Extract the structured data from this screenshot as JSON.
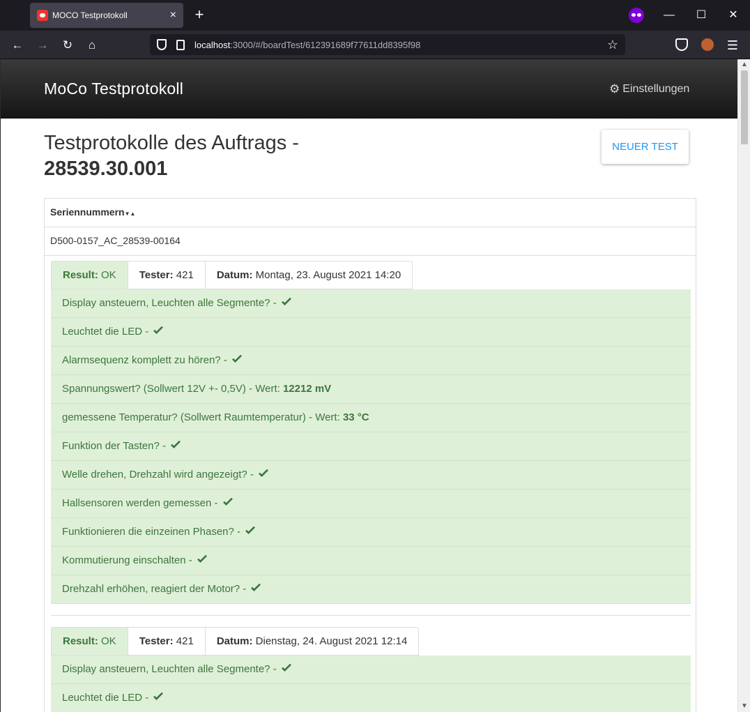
{
  "browser": {
    "tab_title": "MOCO Testprotokoll",
    "tab_close": "×",
    "new_tab": "+",
    "url_host": "localhost",
    "url_rest": ":3000/#/boardTest/612391689f77611dd8395f98",
    "window_minimize": "—",
    "window_maximize": "☐",
    "window_close": "✕"
  },
  "app": {
    "title": "MoCo Testprotokoll",
    "settings_label": "Einstellungen"
  },
  "page": {
    "heading_line1": "Testprotokolle des Auftrags -",
    "order_number": "28539.30.001",
    "new_test_button": "NEUER TEST"
  },
  "table": {
    "column_header": "Seriennummern",
    "serial_number": "D500-0157_AC_28539-00164"
  },
  "tests": [
    {
      "result_label": "Result:",
      "result_value": "OK",
      "tester_label": "Tester:",
      "tester_value": "421",
      "date_label": "Datum:",
      "date_value": "Montag, 23. August 2021 14:20",
      "items": [
        {
          "text": "Display ansteuern, Leuchten alle Segmente? - ",
          "value": "",
          "check": true
        },
        {
          "text": "Leuchtet die LED - ",
          "value": "",
          "check": true
        },
        {
          "text": "Alarmsequenz komplett zu hören? - ",
          "value": "",
          "check": true
        },
        {
          "text": "Spannungswert? (Sollwert 12V +- 0,5V) - Wert: ",
          "value": "12212 mV",
          "check": false
        },
        {
          "text": "gemessene Temperatur? (Sollwert Raumtemperatur) - Wert: ",
          "value": "33 °C",
          "check": false
        },
        {
          "text": "Funktion der Tasten? - ",
          "value": "",
          "check": true
        },
        {
          "text": "Welle drehen, Drehzahl wird angezeigt? - ",
          "value": "",
          "check": true
        },
        {
          "text": "Hallsensoren werden gemessen - ",
          "value": "",
          "check": true
        },
        {
          "text": "Funktionieren die einzeinen Phasen? - ",
          "value": "",
          "check": true
        },
        {
          "text": "Kommutierung einschalten - ",
          "value": "",
          "check": true
        },
        {
          "text": "Drehzahl erhöhen, reagiert der Motor? - ",
          "value": "",
          "check": true
        }
      ]
    },
    {
      "result_label": "Result:",
      "result_value": "OK",
      "tester_label": "Tester:",
      "tester_value": "421",
      "date_label": "Datum:",
      "date_value": "Dienstag, 24. August 2021 12:14",
      "items": [
        {
          "text": "Display ansteuern, Leuchten alle Segmente? - ",
          "value": "",
          "check": true
        },
        {
          "text": "Leuchtet die LED - ",
          "value": "",
          "check": true
        }
      ]
    }
  ],
  "colors": {
    "success_bg": "#dff0d8",
    "success_text": "#3c763d",
    "accent": "#2196f3"
  }
}
